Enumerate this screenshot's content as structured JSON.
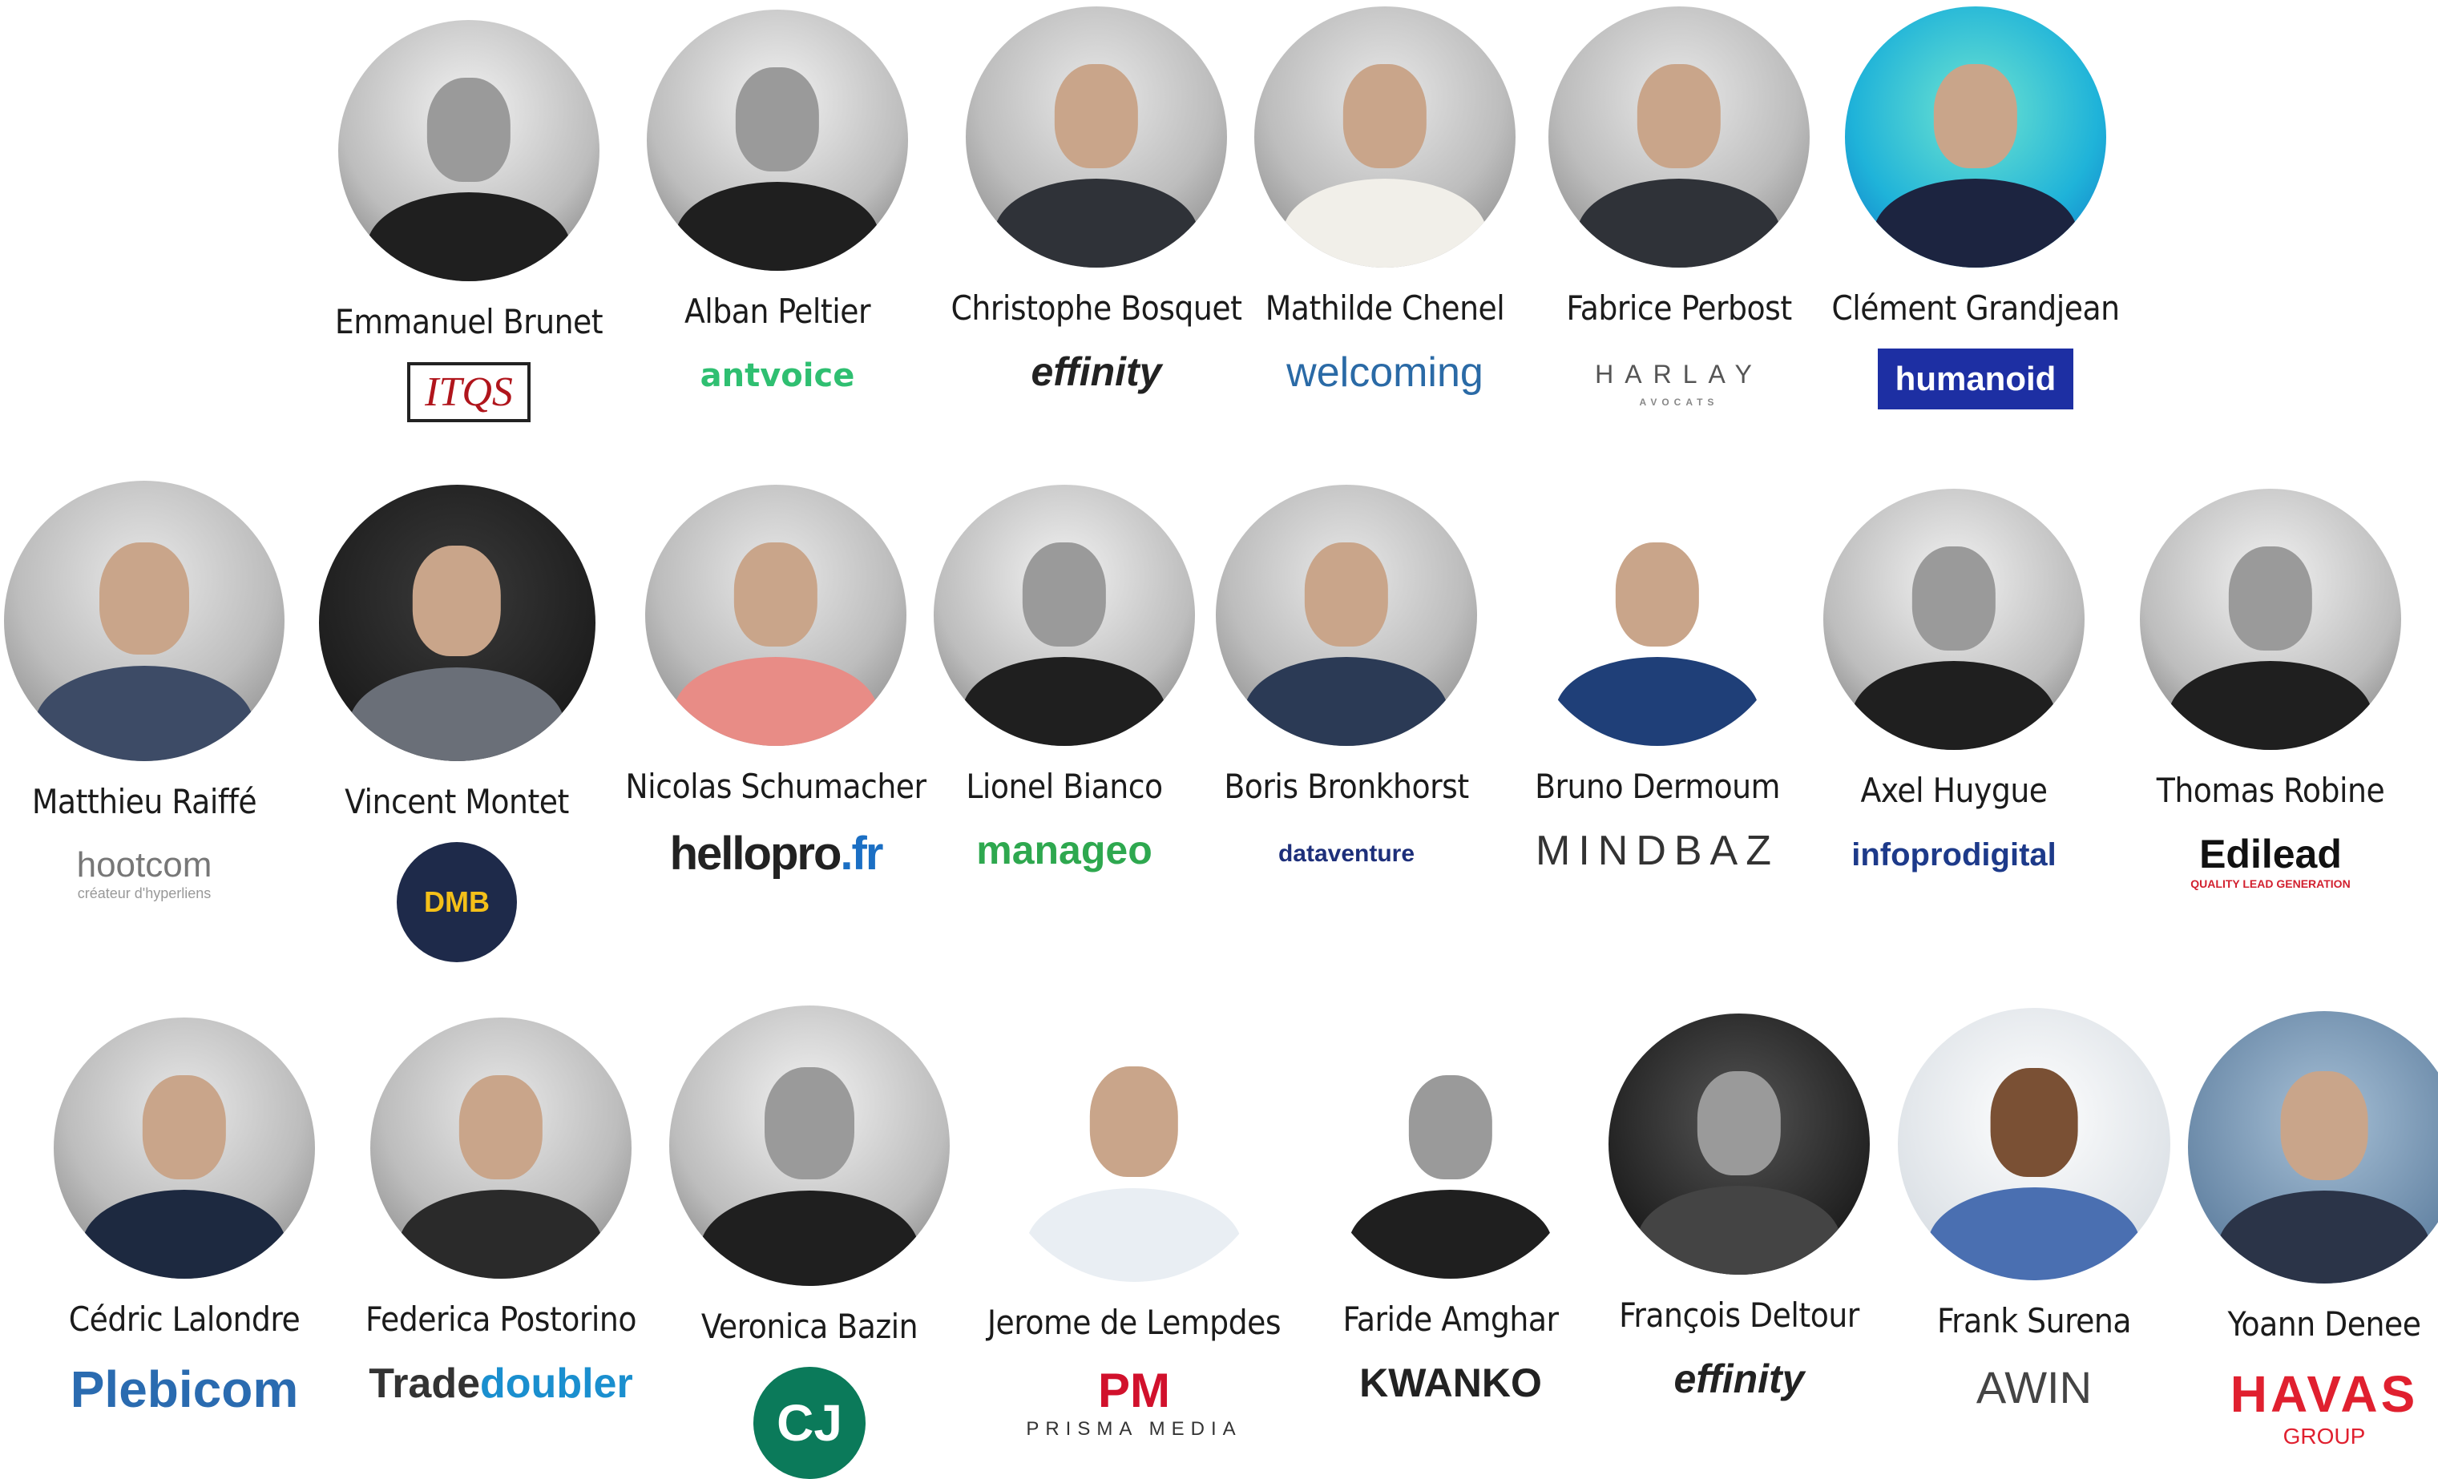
{
  "speakers": [
    {
      "name": "Emmanuel Brunet",
      "logo": "ITQS",
      "photo": "bw"
    },
    {
      "name": "Alban Peltier",
      "logo": "antvoice",
      "photo": "bw"
    },
    {
      "name": "Christophe Bosquet",
      "logo": "effinity",
      "photo": "color"
    },
    {
      "name": "Mathilde Chenel",
      "logo": "welcoming",
      "photo": "color"
    },
    {
      "name": "Fabrice Perbost",
      "logo": "HARLAY",
      "logo_sub": "AVOCATS",
      "photo": "color"
    },
    {
      "name": "Clément Grandjean",
      "logo": "humanoid",
      "photo": "color"
    },
    {
      "name": "Matthieu Raiffé",
      "logo": "hootcom",
      "logo_sub": "créateur d'hyperliens",
      "photo": "color"
    },
    {
      "name": "Vincent Montet",
      "logo": "DMB",
      "photo": "color"
    },
    {
      "name": "Nicolas Schumacher",
      "logo": "hellopro",
      "logo_suffix": ".fr",
      "photo": "color"
    },
    {
      "name": "Lionel Bianco",
      "logo": "manageo",
      "photo": "color"
    },
    {
      "name": "Boris Bronkhorst",
      "logo": "dataventure",
      "photo": "color"
    },
    {
      "name": "Bruno Dermoum",
      "logo": "MINDBAZ",
      "photo": "color"
    },
    {
      "name": "Axel Huygue",
      "logo": "infoprodigital",
      "photo": "bw"
    },
    {
      "name": "Thomas Robine",
      "logo": "Edilead",
      "logo_sub": "QUALITY LEAD GENERATION",
      "photo": "bw"
    },
    {
      "name": "Cédric Lalondre",
      "logo": "Plebicom",
      "photo": "color"
    },
    {
      "name": "Federica Postorino",
      "logo": "Trade",
      "logo_suffix": "doubler",
      "photo": "color"
    },
    {
      "name": "Veronica Bazin",
      "logo": "CJ",
      "photo": "bw"
    },
    {
      "name": "Jerome de Lempdes",
      "logo": "PM",
      "logo_sub": "PRISMA MEDIA",
      "photo": "color"
    },
    {
      "name": "Faride Amghar",
      "logo": "KWANKO",
      "photo": "bw"
    },
    {
      "name": "François Deltour",
      "logo": "effinity",
      "photo": "bw"
    },
    {
      "name": "Frank Surena",
      "logo": "AWIN",
      "photo": "color"
    },
    {
      "name": "Yoann Denee",
      "logo": "HAVAS",
      "logo_sub": "GROUP",
      "photo": "color"
    }
  ]
}
